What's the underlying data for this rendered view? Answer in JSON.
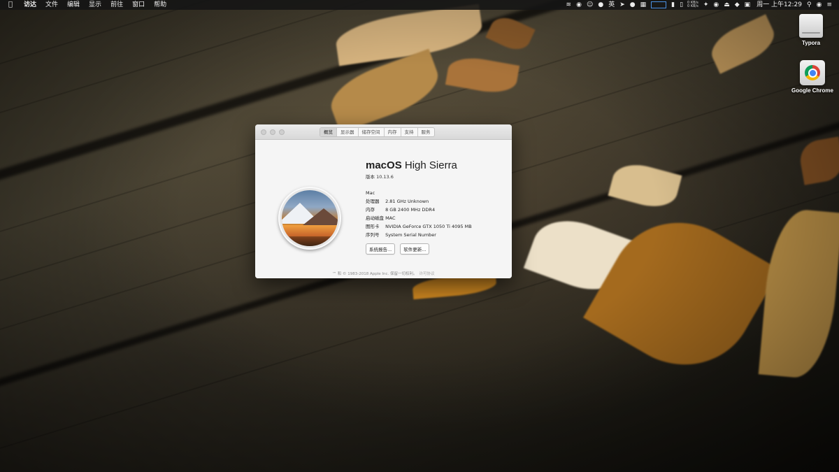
{
  "menubar": {
    "apple_icon": "apple-icon",
    "items": [
      {
        "label": "访达",
        "bold": true
      },
      {
        "label": "文件"
      },
      {
        "label": "编辑"
      },
      {
        "label": "显示"
      },
      {
        "label": "前往"
      },
      {
        "label": "窗口"
      },
      {
        "label": "帮助"
      }
    ],
    "status": {
      "input_method": "英",
      "net_up": "0 KB/s",
      "net_down": "0 KB/s",
      "clock": "周一 上午12:29"
    }
  },
  "desktop": {
    "icons": [
      {
        "label": "Typora",
        "icon": "drive-icon"
      },
      {
        "label": "Google Chrome",
        "icon": "chrome-icon"
      }
    ]
  },
  "about_window": {
    "tabs": [
      "概览",
      "显示器",
      "储存空间",
      "内存",
      "支持",
      "服务"
    ],
    "active_tab": "概览",
    "os_name_bold": "macOS",
    "os_name_light": "High Sierra",
    "version": "版本 10.13.6",
    "model": "Mac",
    "specs": [
      {
        "label": "处理器",
        "value": "2.81 GHz Unknown"
      },
      {
        "label": "内存",
        "value": "8 GB 2400 MHz DDR4"
      },
      {
        "label": "启动磁盘",
        "value": "MAC"
      },
      {
        "label": "图形卡",
        "value": "NVIDIA GeForce GTX 1050 Ti 4095 MB"
      },
      {
        "label": "序列号",
        "value": "System Serial Number"
      }
    ],
    "buttons": {
      "system_report": "系统报告...",
      "software_update": "软件更新..."
    },
    "footer": "™ 和 © 1983-2018 Apple Inc. 保留一切权利。",
    "footer_link": "许可协议"
  }
}
